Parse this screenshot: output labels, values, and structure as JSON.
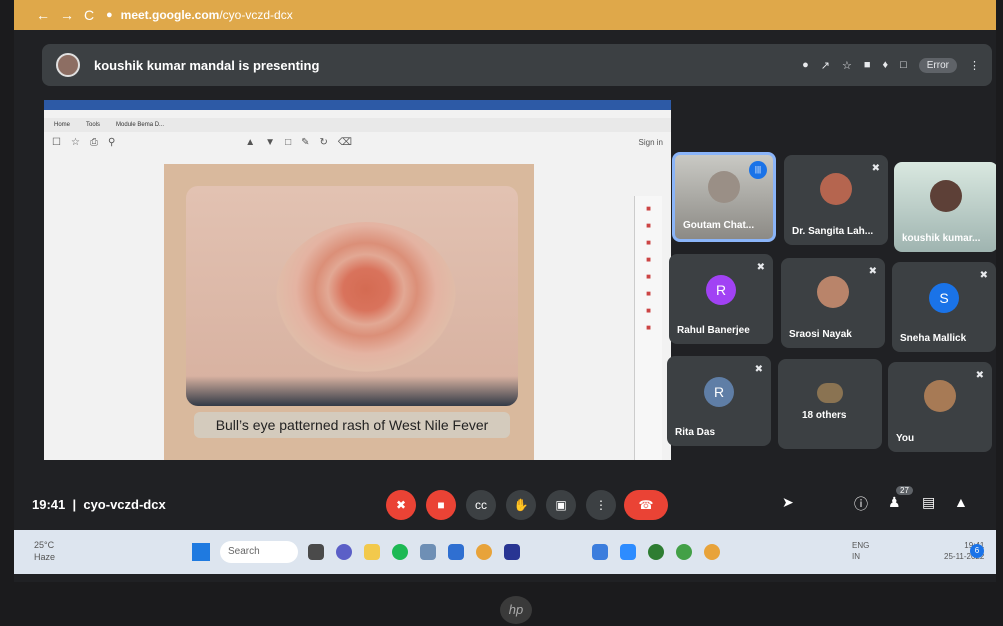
{
  "browser": {
    "url_host": "meet.google.com",
    "url_path": "/cyo-vczd-dcx",
    "profile_label": "Error"
  },
  "presenting": {
    "text": "koushik kumar mandal is presenting"
  },
  "shared_doc": {
    "toolbar_signin": "Sign in",
    "tab_home": "Home",
    "tab_tools": "Tools",
    "tab_file": "Module Bema D...",
    "caption": "Bull’s eye patterned rash of West Nile Fever"
  },
  "participants": [
    {
      "name": "Goutam Chat...",
      "type": "video",
      "speaking": true
    },
    {
      "name": "Dr. Sangita Lah...",
      "type": "photo",
      "muted": true
    },
    {
      "name": "koushik kumar...",
      "type": "video",
      "muted": false
    },
    {
      "name": "Rahul Banerjee",
      "type": "initial",
      "initial": "R",
      "color": "#a142f4",
      "muted": true
    },
    {
      "name": "Sraosi Nayak",
      "type": "photo",
      "muted": true
    },
    {
      "name": "Sneha Mallick",
      "type": "initial",
      "initial": "S",
      "color": "#1a73e8",
      "muted": true
    },
    {
      "name": "Rita Das",
      "type": "initial",
      "initial": "R",
      "color": "#5f7ea6",
      "muted": true
    },
    {
      "name": "18 others",
      "type": "group"
    },
    {
      "name": "You",
      "type": "photo",
      "muted": true
    }
  ],
  "meeting": {
    "time": "19:41",
    "code": "cyo-vczd-dcx",
    "people_count": "27"
  },
  "taskbar": {
    "temp": "25°C",
    "weather": "Haze",
    "search": "Search",
    "lang1": "ENG",
    "lang2": "IN",
    "clock_time": "19:41",
    "clock_date": "25-11-2022",
    "notif_count": "6"
  },
  "colors": {
    "accent_red": "#ea4335",
    "meet_bg": "#202124",
    "tile_bg": "#3c4043",
    "address_bar": "#dfa84a"
  }
}
